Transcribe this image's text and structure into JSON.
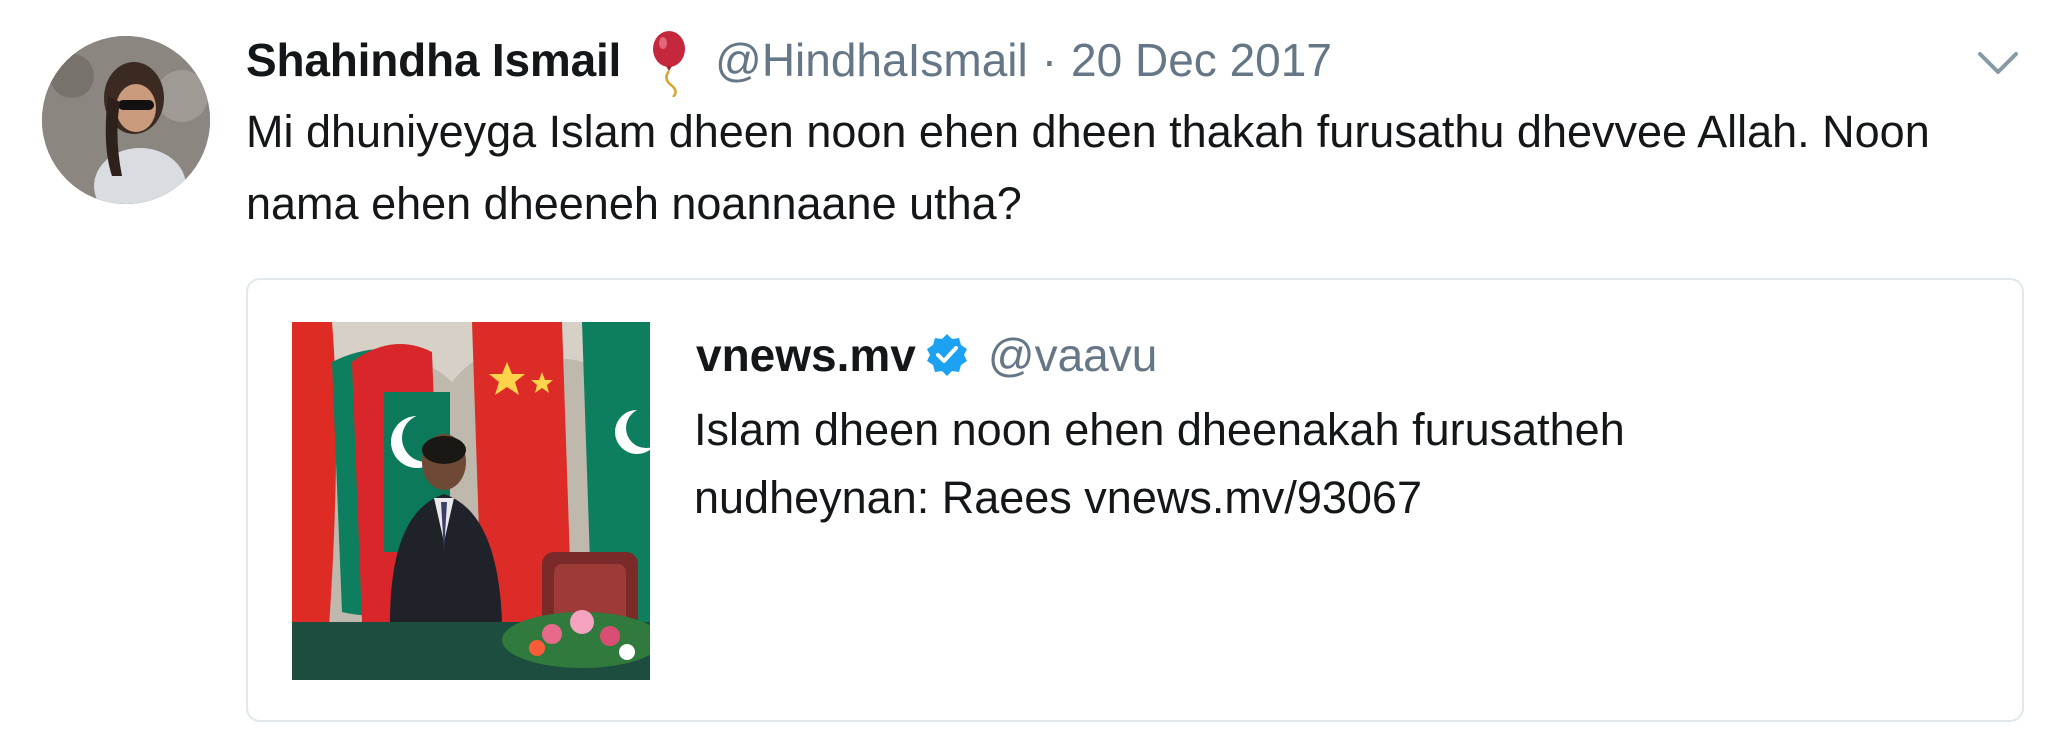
{
  "tweet": {
    "author": {
      "display_name": "Shahindha Ismail",
      "handle": "@HindhaIsmail",
      "avatar_icon": "avatar-photo"
    },
    "separator": "·",
    "date": "20 Dec 2017",
    "text": "Mi dhuniyeyga Islam dheen noon ehen dheen thakah furusathu dhevvee Allah. Noon nama ehen dheeneh noannaane utha?",
    "menu_icon": "chevron-down-icon",
    "badge_icon": "balloon-icon"
  },
  "quoted_tweet": {
    "display_name": "vnews.mv",
    "verified_icon": "verified-badge-icon",
    "handle": "@vaavu",
    "text": "Islam dheen noon ehen dheenakah furusatheh nudheynan: Raees vnews.mv/93067",
    "media_icon": "news-photo"
  },
  "colors": {
    "primary_text": "#14171a",
    "secondary_text": "#657786",
    "border": "#e1e8ed",
    "verified_blue": "#1da1f2",
    "balloon_red": "#c5283d"
  }
}
